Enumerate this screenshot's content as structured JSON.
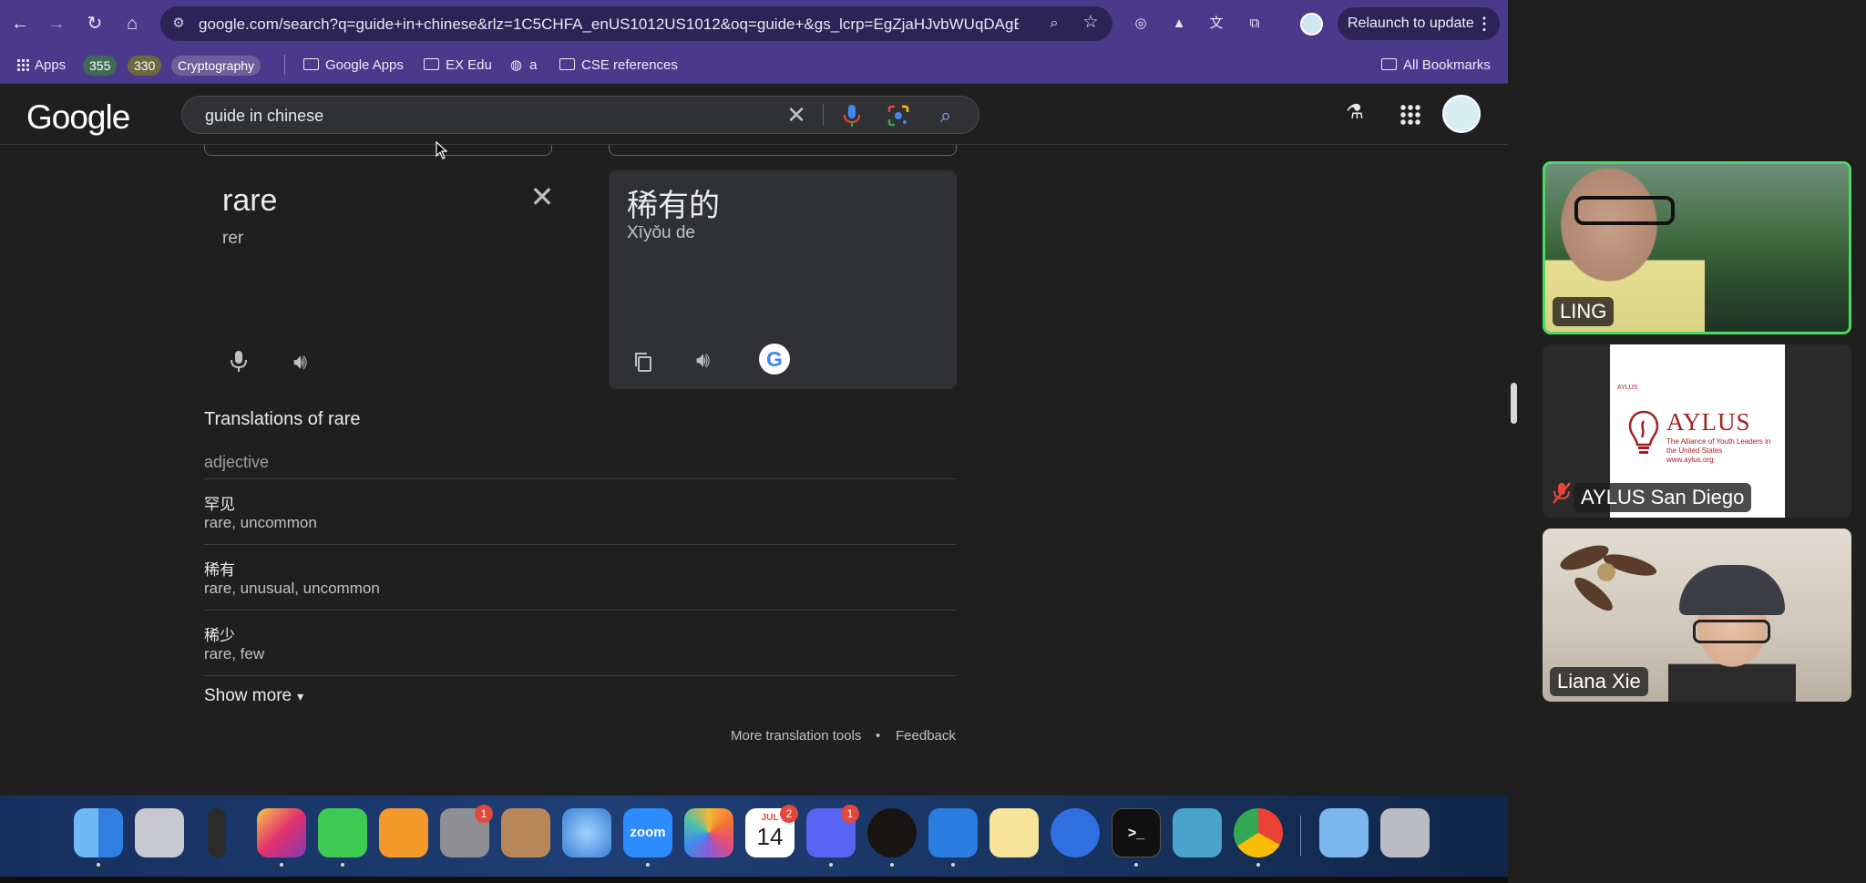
{
  "browser": {
    "url": "google.com/search?q=guide+in+chinese&rlz=1C5CHFA_enUS1012US1012&oq=guide+&gs_lcrp=EgZjaHJvbWUqDAgBE...",
    "relaunch_label": "Relaunch to update"
  },
  "bookmarks": {
    "apps": "Apps",
    "pill_1": "355",
    "pill_2": "330",
    "pill_3": "Cryptography",
    "folder_1": "Google Apps",
    "folder_2": "EX Edu",
    "globe_item": "a",
    "folder_3": "CSE references",
    "all_bookmarks": "All Bookmarks"
  },
  "google": {
    "logo": "Google",
    "query": "guide in chinese"
  },
  "translate": {
    "source_word": "rare",
    "source_phonetic": "rer",
    "target_word": "稀有的",
    "target_pinyin": "Xīyǒu de",
    "section_title": "Translations of rare",
    "part_of_speech": "adjective",
    "rows": [
      {
        "word": "罕见",
        "synonyms": "rare, uncommon"
      },
      {
        "word": "稀有",
        "synonyms": "rare, unusual, uncommon"
      },
      {
        "word": "稀少",
        "synonyms": "rare, few"
      }
    ],
    "show_more": "Show more",
    "more_tools": "More translation tools",
    "separator": "•",
    "feedback": "Feedback"
  },
  "dock": {
    "zoom_label": "zoom",
    "calendar_month": "JUL",
    "calendar_day": "14",
    "badges": {
      "settings": "1",
      "calendar": "2",
      "discord": "1"
    }
  },
  "participants": [
    {
      "name": "LING",
      "active_speaker": true
    },
    {
      "name": "AYLUS San Diego",
      "muted": true
    },
    {
      "name": "Liana Xie"
    }
  ],
  "aylus_slide": {
    "small": "AYLUS",
    "brand": "AYLUS",
    "tagline": "The Alliance of Youth Leaders in the United States",
    "site": "www.aylus.org"
  }
}
